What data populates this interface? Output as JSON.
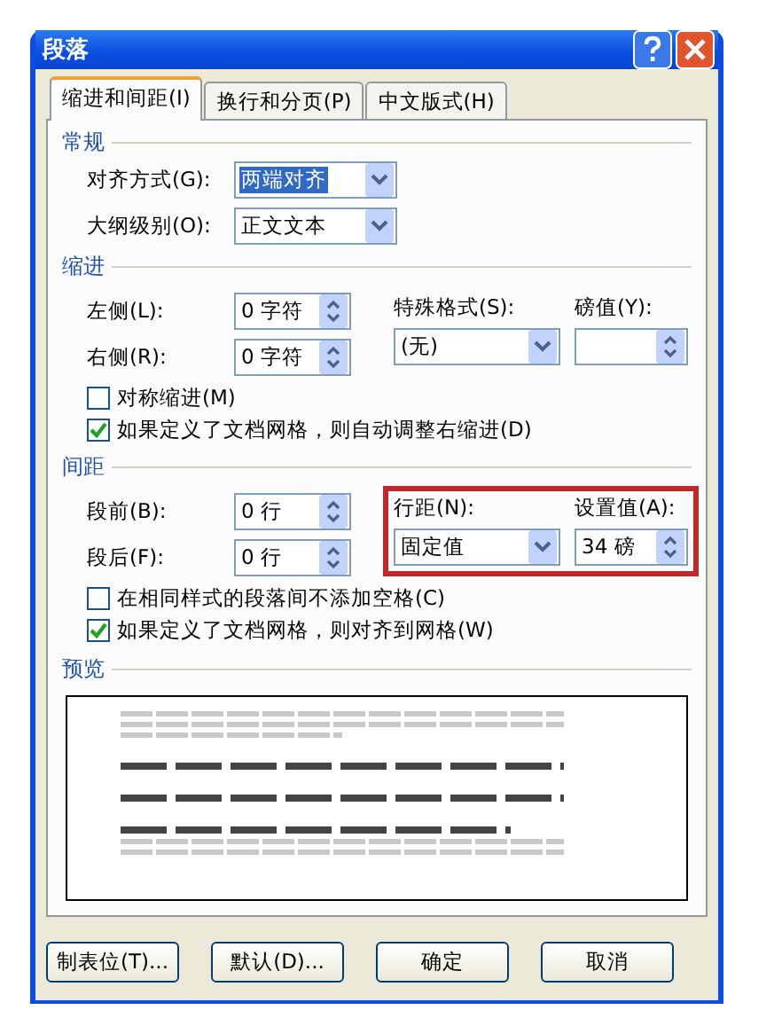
{
  "window": {
    "title": "段落"
  },
  "tabs": [
    {
      "label": "缩进和间距(I)",
      "selected": true
    },
    {
      "label": "换行和分页(P)",
      "selected": false
    },
    {
      "label": "中文版式(H)",
      "selected": false
    }
  ],
  "sections": [
    {
      "title": "常规",
      "left_fields": [
        {
          "label": "对齐方式(G):",
          "kind": "dropdown",
          "value": "两端对齐",
          "selected": true
        },
        {
          "label": "大纲级别(O):",
          "kind": "dropdown",
          "value": "正文文本",
          "selected": false
        }
      ]
    },
    {
      "title": "缩进",
      "left_fields": [
        {
          "label": "左侧(L):",
          "kind": "spinner",
          "value": "0 字符"
        },
        {
          "label": "右侧(R):",
          "kind": "spinner",
          "value": "0 字符"
        }
      ],
      "right_fields": [
        {
          "label": "特殊格式(S):",
          "kind": "dropdown",
          "value": "(无)",
          "selected": false
        },
        {
          "label": "磅值(Y):",
          "kind": "spinner"
        }
      ],
      "checkboxes": [
        {
          "label": "对称缩进(M)",
          "checked": false
        },
        {
          "label": "如果定义了文档网格，则自动调整右缩进(D)",
          "checked": true
        }
      ]
    },
    {
      "title": "间距",
      "left_fields": [
        {
          "label": "段前(B):",
          "kind": "spinner",
          "value": "0 行"
        },
        {
          "label": "段后(F):",
          "kind": "spinner",
          "value": "0 行"
        }
      ],
      "right_fields": [
        {
          "label": "行距(N):",
          "kind": "dropdown",
          "value": "固定值",
          "selected": false
        },
        {
          "label": "设置值(A):",
          "kind": "spinner",
          "value": "34 磅"
        }
      ],
      "annotated": true,
      "checkboxes": [
        {
          "label": "在相同样式的段落间不添加空格(C)",
          "checked": false
        },
        {
          "label": "如果定义了文档网格，则对齐到网格(W)",
          "checked": true
        }
      ]
    }
  ],
  "preview": {
    "title": "预览"
  },
  "buttons": [
    "制表位(T)...",
    "默认(D)...",
    "确定",
    "取消"
  ]
}
